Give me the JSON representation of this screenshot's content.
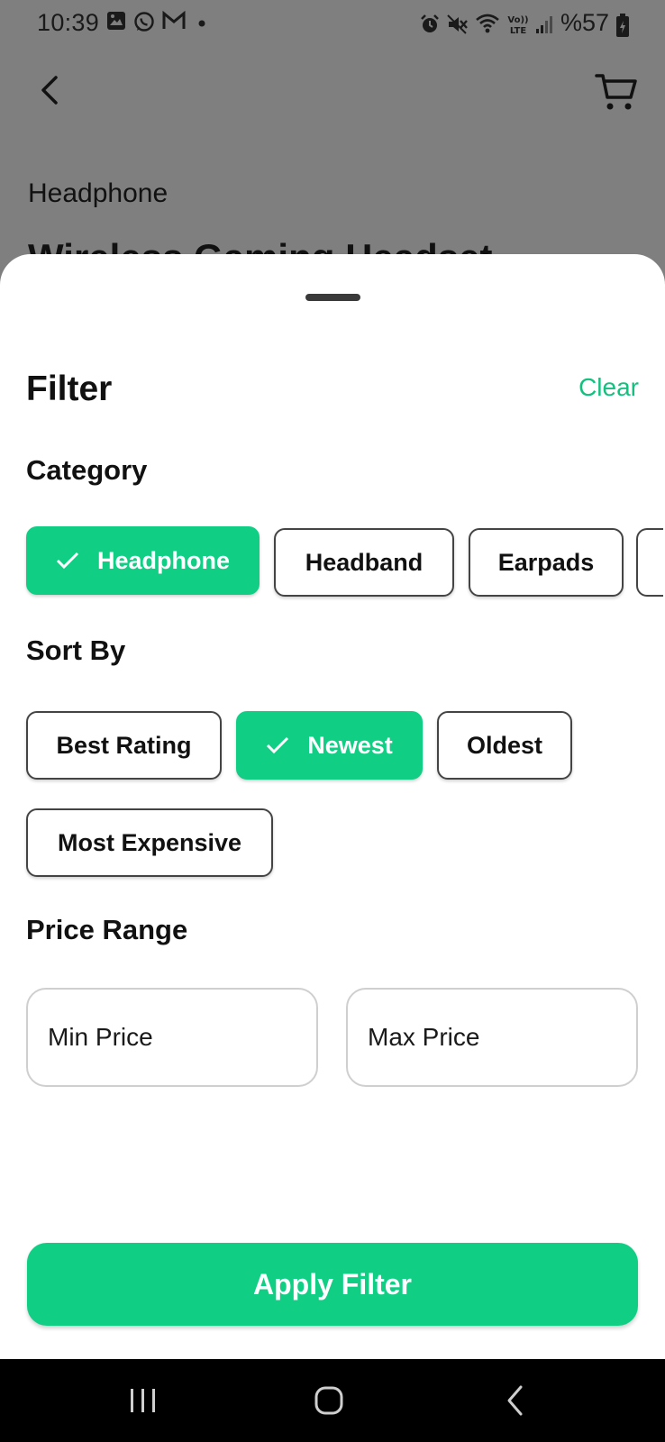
{
  "status_bar": {
    "time": "10:39",
    "battery": "%57",
    "left_icons": [
      "gallery-icon",
      "whatsapp-icon",
      "gmail-icon",
      "dot-icon"
    ],
    "right_icons": [
      "alarm-icon",
      "mute-icon",
      "wifi-icon",
      "volte-icon",
      "signal-icon",
      "battery-icon"
    ]
  },
  "background_page": {
    "category": "Headphone",
    "product_title": "Wireless Gaming Headset"
  },
  "filter_sheet": {
    "title": "Filter",
    "clear_label": "Clear",
    "category": {
      "label": "Category",
      "options": [
        {
          "label": "Headphone",
          "selected": true
        },
        {
          "label": "Headband",
          "selected": false
        },
        {
          "label": "Earpads",
          "selected": false
        }
      ]
    },
    "sort_by": {
      "label": "Sort By",
      "options": [
        {
          "label": "Best Rating",
          "selected": false
        },
        {
          "label": "Newest",
          "selected": true
        },
        {
          "label": "Oldest",
          "selected": false
        },
        {
          "label": "Most Expensive",
          "selected": false
        }
      ]
    },
    "price_range": {
      "label": "Price Range",
      "min_placeholder": "Min Price",
      "min_value": "",
      "max_placeholder": "Max Price",
      "max_value": ""
    },
    "apply_label": "Apply Filter"
  },
  "colors": {
    "accent": "#10cf85",
    "accent_text": "#13c07f",
    "scrim": "#7f7f7f"
  },
  "nav_bar": {
    "buttons": [
      "recent-apps-icon",
      "home-icon",
      "back-icon"
    ]
  }
}
